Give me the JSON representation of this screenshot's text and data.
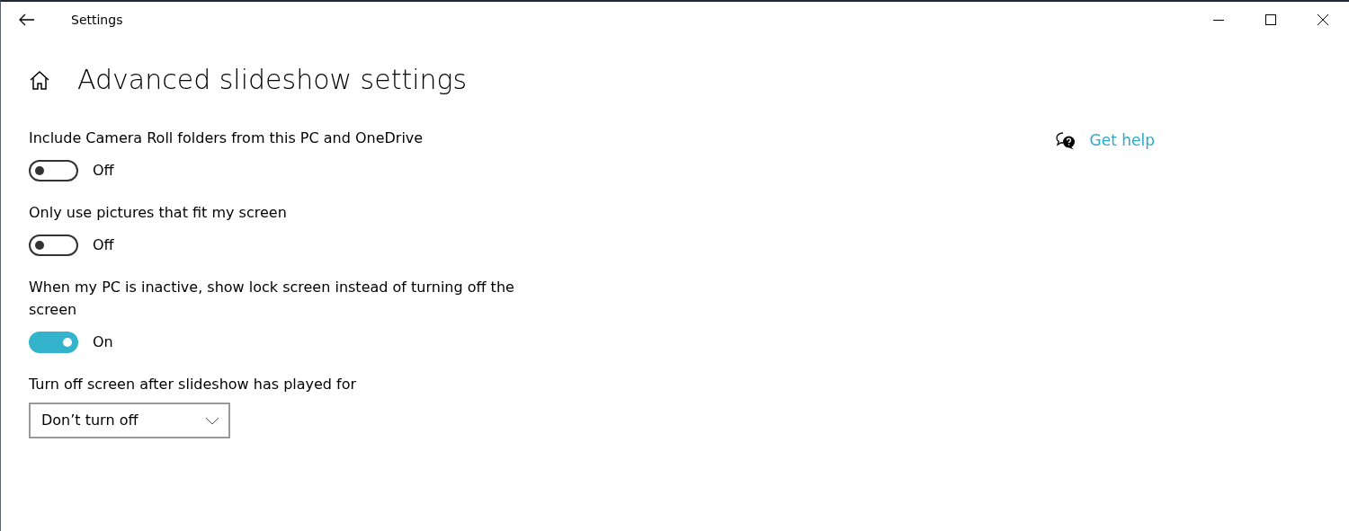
{
  "window": {
    "title": "Settings"
  },
  "page": {
    "title": "Advanced slideshow settings"
  },
  "settings": [
    {
      "kind": "toggle",
      "label": "Include Camera Roll folders from this PC and OneDrive",
      "on": false,
      "state_text": "Off"
    },
    {
      "kind": "toggle",
      "label": "Only use pictures that fit my screen",
      "on": false,
      "state_text": "Off"
    },
    {
      "kind": "toggle",
      "label": "When my PC is inactive, show lock screen instead of turning off the screen",
      "on": true,
      "state_text": "On"
    },
    {
      "kind": "dropdown",
      "label": "Turn off screen after slideshow has played for",
      "value": "Don’t turn off"
    }
  ],
  "help": {
    "link": "Get help"
  }
}
